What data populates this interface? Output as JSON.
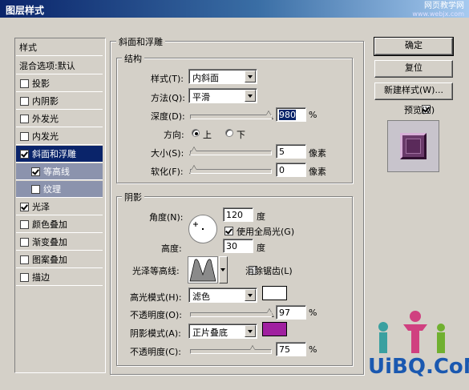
{
  "window": {
    "title": "图层样式",
    "watermark_top": "网页教学网",
    "watermark_top_sub": "www.webjx.com",
    "watermark_bottom": "UiBQ.CoM"
  },
  "style_list": {
    "header": "样式",
    "blend": "混合选项:默认",
    "items": [
      {
        "label": "投影",
        "checked": false
      },
      {
        "label": "内阴影",
        "checked": false
      },
      {
        "label": "外发光",
        "checked": false
      },
      {
        "label": "内发光",
        "checked": false
      },
      {
        "label": "斜面和浮雕",
        "checked": true
      },
      {
        "label": "等高线",
        "checked": true
      },
      {
        "label": "纹理",
        "checked": false
      },
      {
        "label": "光泽",
        "checked": true
      },
      {
        "label": "颜色叠加",
        "checked": false
      },
      {
        "label": "渐变叠加",
        "checked": false
      },
      {
        "label": "图案叠加",
        "checked": false
      },
      {
        "label": "描边",
        "checked": false
      }
    ]
  },
  "bevel": {
    "group_title": "斜面和浮雕",
    "structure_title": "结构",
    "style_label": "样式(T):",
    "style_value": "内斜面",
    "technique_label": "方法(Q):",
    "technique_value": "平滑",
    "depth_label": "深度(D):",
    "depth_value": "980",
    "depth_unit": "%",
    "direction_label": "方向:",
    "dir_up": "上",
    "dir_down": "下",
    "size_label": "大小(S):",
    "size_value": "5",
    "size_unit": "像素",
    "soften_label": "软化(F):",
    "soften_value": "0",
    "soften_unit": "像素"
  },
  "shading": {
    "title": "阴影",
    "angle_label": "角度(N):",
    "angle_value": "120",
    "angle_unit": "度",
    "global_light_label": "使用全局光(G)",
    "altitude_label": "高度:",
    "altitude_value": "30",
    "altitude_unit": "度",
    "gloss_contour_label": "光泽等高线:",
    "anti_alias_label": "消除锯齿(L)",
    "highlight_mode_label": "高光模式(H):",
    "highlight_mode_value": "滤色",
    "highlight_color": "#ffffff",
    "opacity1_label": "不透明度(O):",
    "opacity1_value": "97",
    "opacity1_unit": "%",
    "shadow_mode_label": "阴影模式(A):",
    "shadow_mode_value": "正片叠底",
    "shadow_color": "#a020a0",
    "opacity2_label": "不透明度(C):",
    "opacity2_value": "75",
    "opacity2_unit": "%"
  },
  "buttons": {
    "ok": "确定",
    "reset": "复位",
    "new_style": "新建样式(W)...",
    "preview_label": "预览(V)"
  }
}
